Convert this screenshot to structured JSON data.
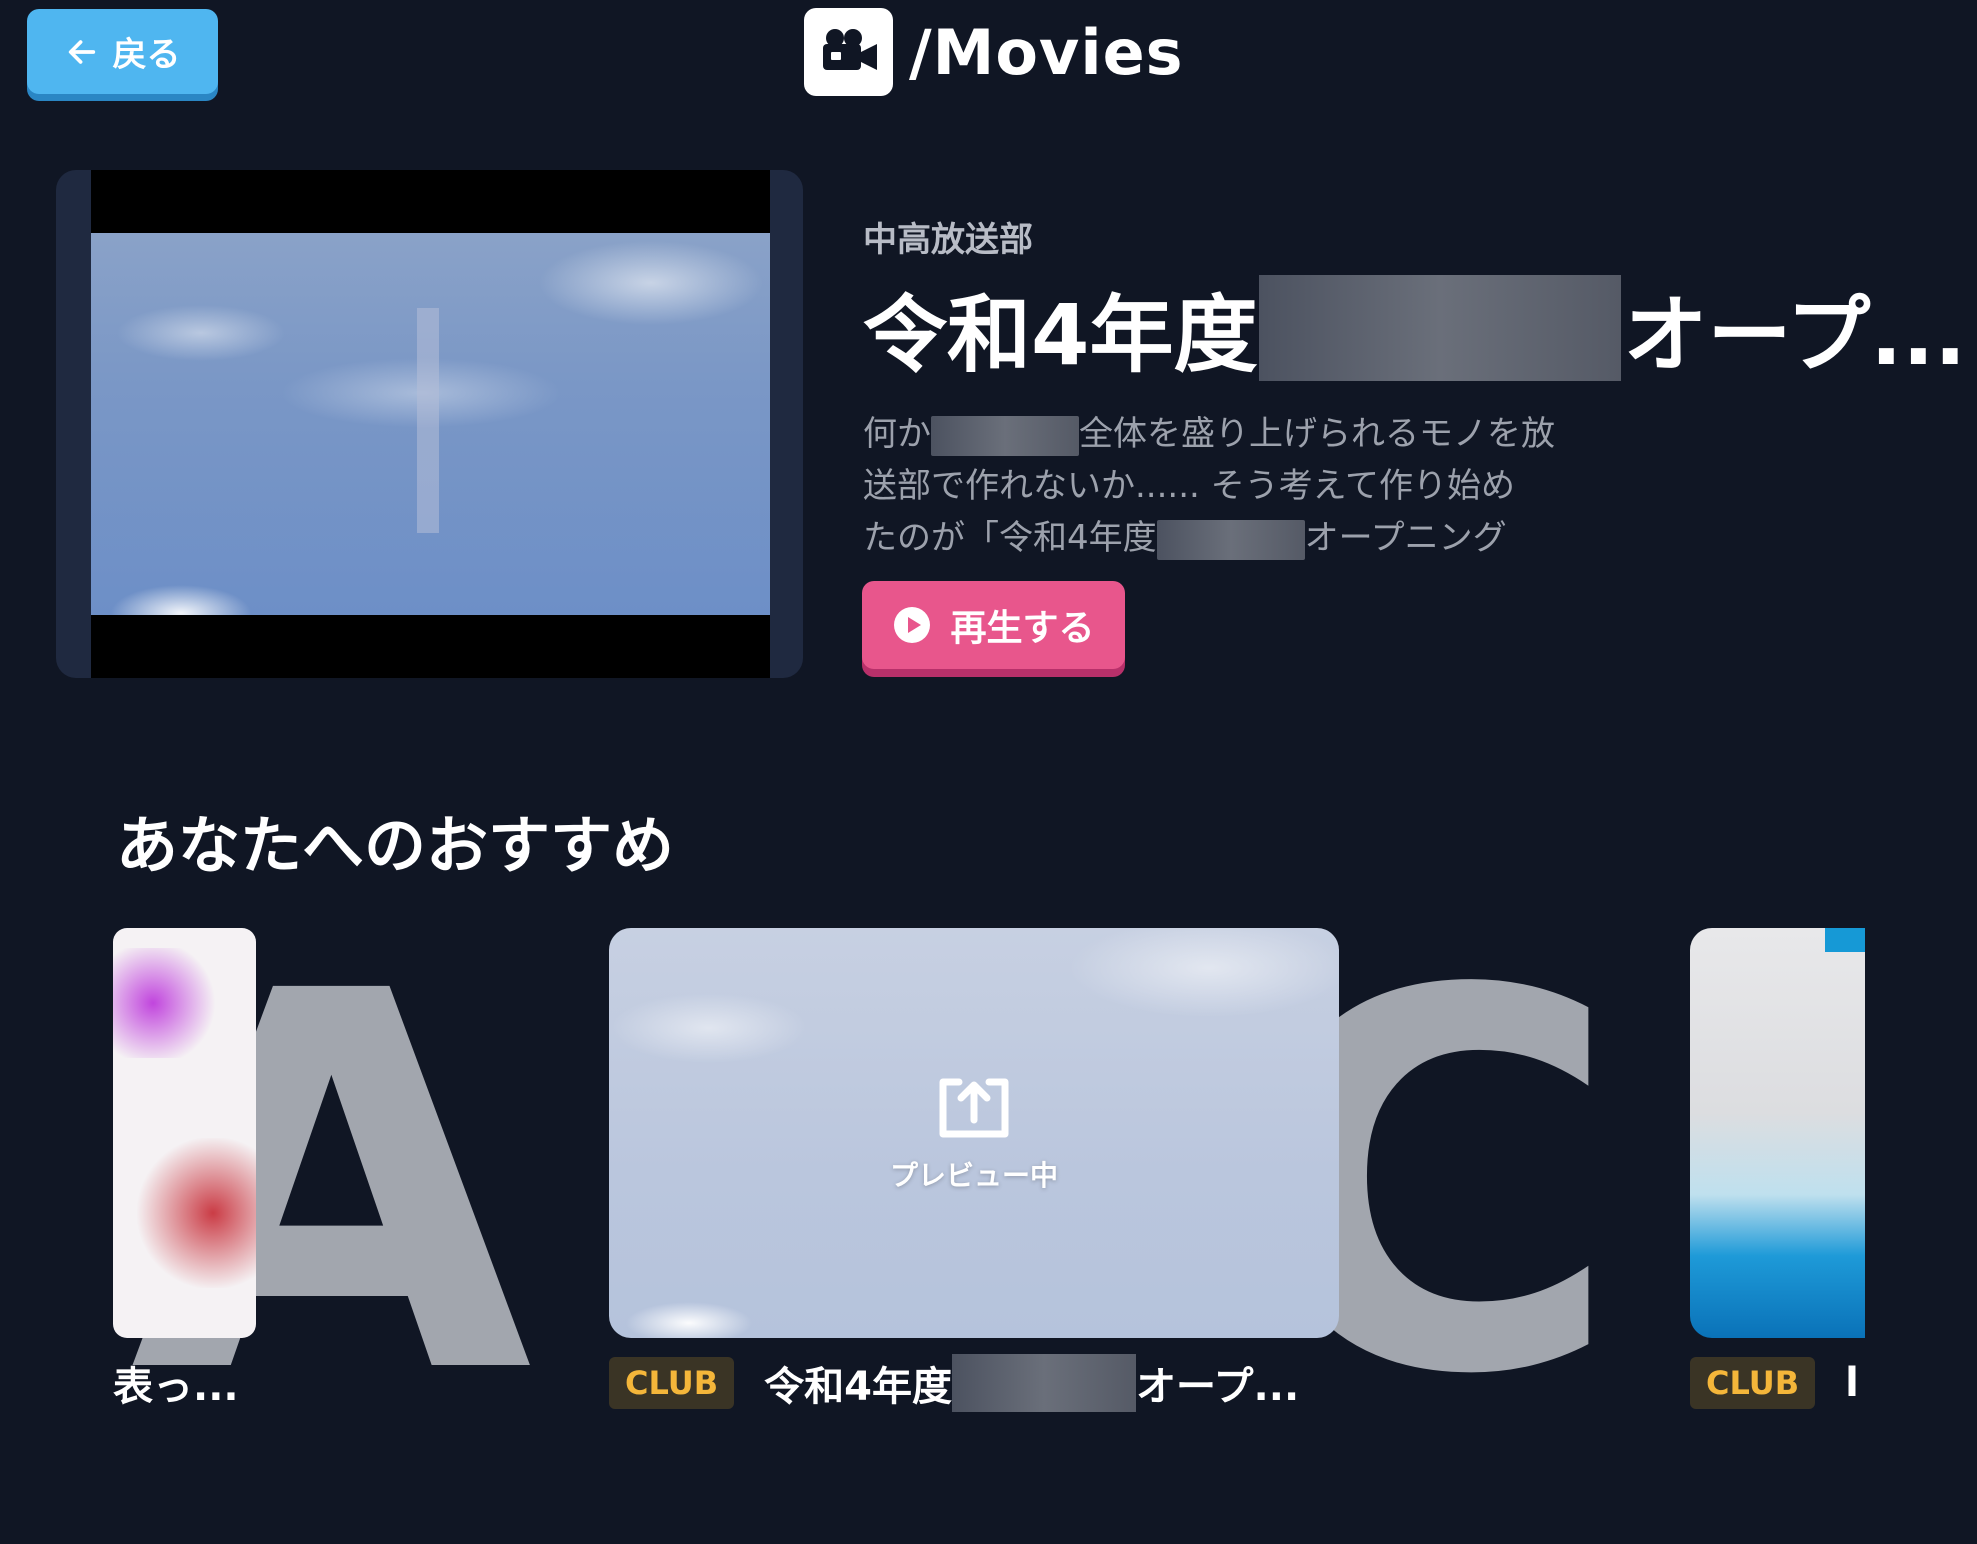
{
  "header": {
    "back_label": "戻る",
    "title": "/Movies"
  },
  "hero": {
    "club_name": "中高放送部",
    "title_before": "令和4年度",
    "title_after": "オープ...",
    "desc_line1_before": "何か",
    "desc_line1_after": "全体を盛り上げられるモノを放",
    "desc_line2": "送部で作れないか...... そう考えて作り始め",
    "desc_line3_before": "たのが「令和4年度",
    "desc_line3_after": "オープニング",
    "play_label": "再生する"
  },
  "recommendations": {
    "section_title": "あなたへのおすすめ",
    "background_letters": [
      "A",
      "C"
    ],
    "cards": [
      {
        "caption": "表っ..."
      },
      {
        "badge": "CLUB",
        "caption_before": "令和4年度",
        "caption_after": "オープ...",
        "overlay_label": "プレビュー中"
      },
      {
        "badge": "CLUB",
        "caption": "l"
      }
    ]
  },
  "colors": {
    "background": "#101624",
    "back_button": "#4fb6f0",
    "play_button": "#e8568c",
    "club_badge_text": "#f4b63a"
  },
  "icons": {
    "back": "arrow-left-icon",
    "logo": "movie-camera-icon",
    "play": "play-circle-icon",
    "preview": "share-upload-icon"
  }
}
